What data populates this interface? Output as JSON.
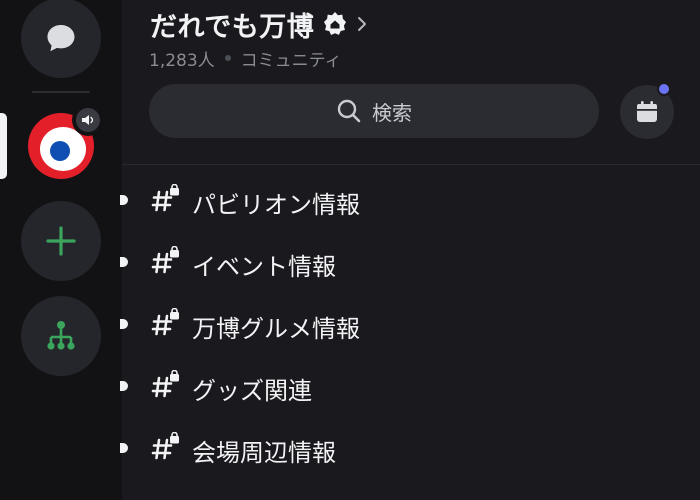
{
  "rail": {
    "items": [
      {
        "name": "direct-messages",
        "icon": "chat-bubble-icon"
      },
      {
        "name": "server",
        "icon": "server-logo-icon",
        "badge_icon": "speaker-icon"
      },
      {
        "name": "add-server",
        "icon": "plus-icon"
      },
      {
        "name": "discover",
        "icon": "hub-tree-icon"
      }
    ],
    "colors": {
      "accent_green": "#3ba55d",
      "server_red": "#e3202a"
    }
  },
  "server": {
    "name": "だれでも万博",
    "member_count": "1,283人",
    "type_label": "コミュニティ"
  },
  "search": {
    "label": "検索"
  },
  "events": {
    "icon": "calendar-icon",
    "has_notification": true,
    "notification_color": "#6b74f5"
  },
  "channels": [
    {
      "name": "パビリオン情報",
      "unread": true,
      "icon": "locked-hash-icon"
    },
    {
      "name": "イベント情報",
      "unread": true,
      "icon": "locked-hash-icon"
    },
    {
      "name": "万博グルメ情報",
      "unread": true,
      "icon": "locked-hash-icon"
    },
    {
      "name": "グッズ関連",
      "unread": true,
      "icon": "locked-hash-icon"
    },
    {
      "name": "会場周辺情報",
      "unread": true,
      "icon": "locked-hash-icon"
    }
  ]
}
